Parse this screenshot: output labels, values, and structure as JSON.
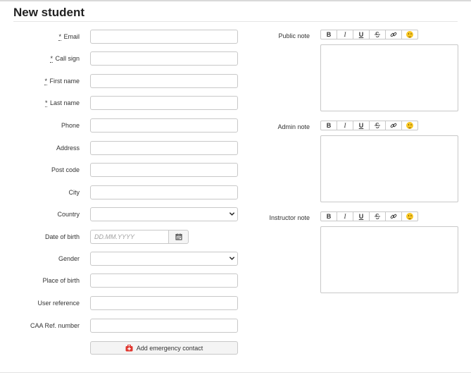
{
  "page": {
    "title": "New student"
  },
  "form": {
    "required_marker": "*",
    "fields": [
      {
        "key": "email",
        "label": "Email",
        "required": true,
        "type": "text",
        "value": ""
      },
      {
        "key": "call_sign",
        "label": "Call sign",
        "required": true,
        "type": "text",
        "value": ""
      },
      {
        "key": "first_name",
        "label": "First name",
        "required": true,
        "type": "text",
        "value": ""
      },
      {
        "key": "last_name",
        "label": "Last name",
        "required": true,
        "type": "text",
        "value": ""
      },
      {
        "key": "phone",
        "label": "Phone",
        "required": false,
        "type": "text",
        "value": ""
      },
      {
        "key": "address",
        "label": "Address",
        "required": false,
        "type": "text",
        "value": ""
      },
      {
        "key": "post_code",
        "label": "Post code",
        "required": false,
        "type": "text",
        "value": ""
      },
      {
        "key": "city",
        "label": "City",
        "required": false,
        "type": "text",
        "value": ""
      },
      {
        "key": "country",
        "label": "Country",
        "required": false,
        "type": "select",
        "value": ""
      },
      {
        "key": "date_of_birth",
        "label": "Date of birth",
        "required": false,
        "type": "date",
        "placeholder": "DD.MM.YYYY",
        "value": ""
      },
      {
        "key": "gender",
        "label": "Gender",
        "required": false,
        "type": "select",
        "value": ""
      },
      {
        "key": "place_of_birth",
        "label": "Place of birth",
        "required": false,
        "type": "text",
        "value": ""
      },
      {
        "key": "user_reference",
        "label": "User reference",
        "required": false,
        "type": "text",
        "value": ""
      },
      {
        "key": "caa_ref_number",
        "label": "CAA Ref. number",
        "required": false,
        "type": "text",
        "value": ""
      }
    ],
    "add_emergency_contact_label": "Add emergency contact"
  },
  "notes": {
    "toolbar": {
      "bold": "B",
      "italic": "I",
      "underline": "U"
    },
    "items": [
      {
        "key": "public_note",
        "label": "Public note"
      },
      {
        "key": "admin_note",
        "label": "Admin note"
      },
      {
        "key": "instructor_note",
        "label": "Instructor note"
      }
    ]
  },
  "icons": {
    "date_picker": "calendar-icon",
    "emergency": "first-aid-kit-icon",
    "select_caret": "chevron-down-icon",
    "strike": "strikethrough-icon",
    "link": "link-icon",
    "emoji": "emoji-icon"
  },
  "colors": {
    "emergency_icon": "#e0372f",
    "emoji": "#f7c623"
  }
}
